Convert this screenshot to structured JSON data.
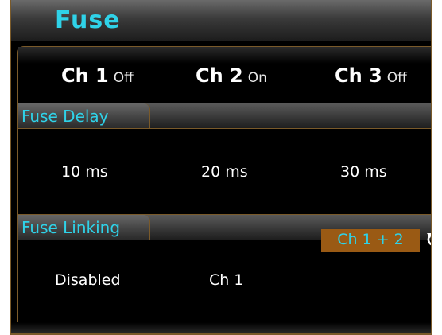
{
  "title": "Fuse",
  "channels": [
    {
      "label": "Ch 1",
      "state": "Off"
    },
    {
      "label": "Ch 2",
      "state": "On"
    },
    {
      "label": "Ch 3",
      "state": "Off"
    }
  ],
  "fuse_delay": {
    "label": "Fuse Delay",
    "values": [
      "10 ms",
      "20 ms",
      "30 ms"
    ]
  },
  "fuse_linking": {
    "label": "Fuse Linking",
    "values": [
      "Disabled",
      "Ch 1",
      "Ch 1 + 2"
    ],
    "selected_index": 2
  },
  "icons": {
    "cycle": "cycle-icon"
  },
  "colors": {
    "accent": "#2fd2e8",
    "selection": "#9a5a14",
    "border": "#7a5a2a"
  }
}
